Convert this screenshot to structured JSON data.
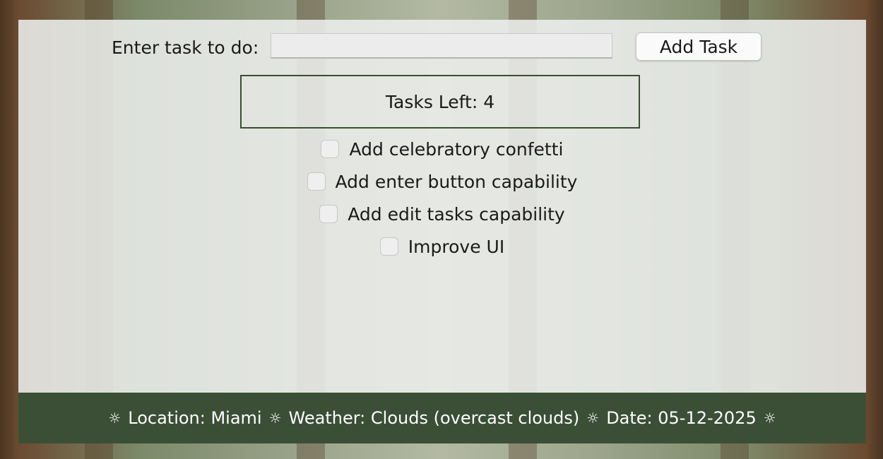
{
  "form": {
    "label": "Enter task to do:",
    "input_value": "",
    "input_placeholder": "",
    "add_button_label": "Add Task"
  },
  "counter": {
    "text": "Tasks Left: 4"
  },
  "tasks": [
    {
      "label": "Add celebratory confetti",
      "checked": false
    },
    {
      "label": "Add enter button capability",
      "checked": false
    },
    {
      "label": "Add edit tasks capability",
      "checked": false
    },
    {
      "label": "Improve UI",
      "checked": false
    }
  ],
  "footer": {
    "separator_icon": "sun-icon",
    "separator_glyph": "☼",
    "location": "Location: Miami",
    "weather": "Weather: Clouds (overcast clouds)",
    "date": "Date: 05-12-2025",
    "bar_color": "#3b4f37"
  }
}
